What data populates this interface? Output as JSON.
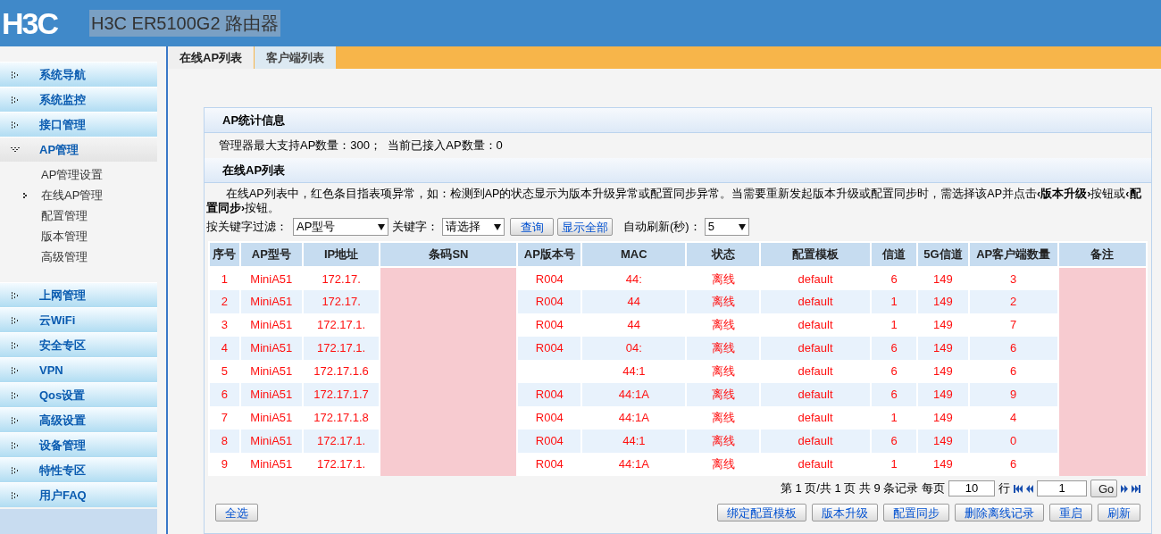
{
  "header": {
    "logo": "H3C",
    "title": "H3C ER5100G2 路由器"
  },
  "tabs": [
    {
      "label": "在线AP列表",
      "selected": true
    },
    {
      "label": "客户端列表",
      "selected": false
    }
  ],
  "sidebar": {
    "items": [
      {
        "label": "系统导航",
        "expanded": false
      },
      {
        "label": "系统监控",
        "expanded": false
      },
      {
        "label": "接口管理",
        "expanded": false
      },
      {
        "label": "AP管理",
        "expanded": true,
        "children": [
          {
            "label": "AP管理设置",
            "selected": false
          },
          {
            "label": "在线AP管理",
            "selected": true
          },
          {
            "label": "配置管理",
            "selected": false
          },
          {
            "label": "版本管理",
            "selected": false
          },
          {
            "label": "高级管理",
            "selected": false
          }
        ]
      },
      {
        "label": "上网管理",
        "expanded": false
      },
      {
        "label": "云WiFi",
        "expanded": false
      },
      {
        "label": "安全专区",
        "expanded": false
      },
      {
        "label": "VPN",
        "expanded": false
      },
      {
        "label": "Qos设置",
        "expanded": false
      },
      {
        "label": "高级设置",
        "expanded": false
      },
      {
        "label": "设备管理",
        "expanded": false
      },
      {
        "label": "特性专区",
        "expanded": false
      },
      {
        "label": "用户FAQ",
        "expanded": false
      }
    ]
  },
  "stats": {
    "title": "AP统计信息",
    "text": "管理器最大支持AP数量：300；  当前已接入AP数量：0"
  },
  "list": {
    "title": "在线AP列表",
    "note": "在线AP列表中，红色条目指表项异常，如：检测到AP的状态显示为版本升级异常或配置同步异常。当需要重新发起版本升级或配置同步时，需选择该AP并点击**‹版本升级›**按钮或**‹配置同步›**按钮。"
  },
  "filter": {
    "label": "按关键字过滤：",
    "field": "AP型号",
    "keyword_label": "关键字：",
    "keyword": "请选择",
    "query": "查询",
    "show_all": "显示全部",
    "refresh_label": "自动刷新(秒)：",
    "refresh": "5"
  },
  "table": {
    "columns": [
      "序号",
      "AP型号",
      "IP地址",
      "条码SN",
      "AP版本号",
      "MAC",
      "状态",
      "配置模板",
      "信道",
      "5G信道",
      "AP客户端数量",
      "备注"
    ],
    "rows": [
      [
        "1",
        "MiniA51",
        "172.17.",
        "",
        "R004",
        "44:",
        "离线",
        "default",
        "6",
        "149",
        "3",
        ""
      ],
      [
        "2",
        "MiniA51",
        "172.17.",
        "",
        "R004",
        "44",
        "离线",
        "default",
        "1",
        "149",
        "2",
        ""
      ],
      [
        "3",
        "MiniA51",
        "172.17.1.",
        "",
        "R004",
        "44",
        "离线",
        "default",
        "1",
        "149",
        "7",
        ""
      ],
      [
        "4",
        "MiniA51",
        "172.17.1.",
        "",
        "R004",
        "04:",
        "离线",
        "default",
        "6",
        "149",
        "6",
        ""
      ],
      [
        "5",
        "MiniA51",
        "172.17.1.6",
        "",
        "",
        "44:1",
        "离线",
        "default",
        "6",
        "149",
        "6",
        ""
      ],
      [
        "6",
        "MiniA51",
        "172.17.1.7",
        "",
        "R004",
        "44:1A",
        "离线",
        "default",
        "6",
        "149",
        "9",
        ""
      ],
      [
        "7",
        "MiniA51",
        "172.17.1.8",
        "",
        "R004",
        "44:1A",
        "离线",
        "default",
        "1",
        "149",
        "4",
        ""
      ],
      [
        "8",
        "MiniA51",
        "172.17.1.",
        "",
        "R004",
        "44:1",
        "离线",
        "default",
        "6",
        "149",
        "0",
        ""
      ],
      [
        "9",
        "MiniA51",
        "172.17.1.",
        "",
        "R004",
        "44:1A",
        "离线",
        "default",
        "1",
        "149",
        "6",
        ""
      ]
    ]
  },
  "pagination": {
    "info": "第 1 页/共 1 页 共 9 条记录 每页",
    "per_page": "10",
    "rows_label": "行",
    "page": "1",
    "go": "Go"
  },
  "buttons_left": [
    "全选"
  ],
  "buttons_right": [
    "绑定配置模板",
    "版本升级",
    "配置同步",
    "删除离线记录",
    "重启",
    "刷新"
  ]
}
